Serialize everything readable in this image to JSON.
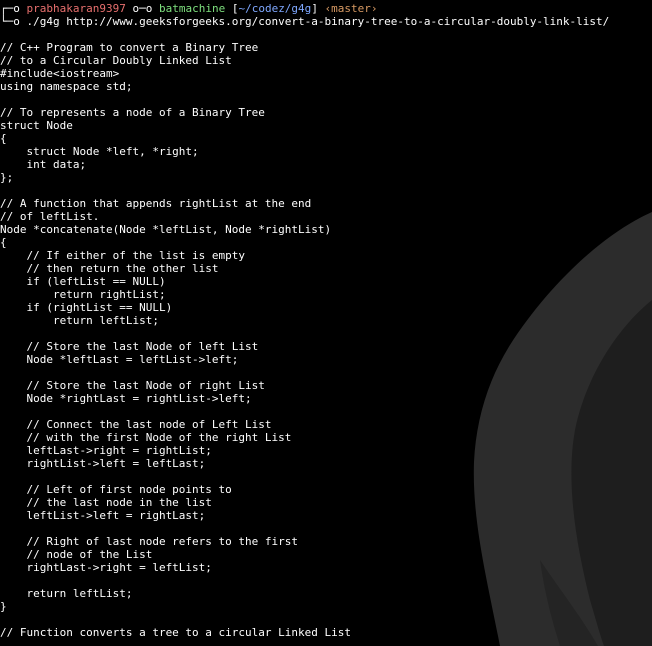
{
  "prompt": {
    "line1": {
      "corner": "┌─o ",
      "user": "prabhakaran9397",
      "sep1": " o─o ",
      "host": "batmachine",
      "space1": " ",
      "dir_open": "[",
      "dir": "~/codez/g4g",
      "dir_close": "]",
      "space2": " ",
      "branch": "‹master›"
    },
    "line2": {
      "corner": "└─o ",
      "command": "./g4g http://www.geeksforgeeks.org/convert-a-binary-tree-to-a-circular-doubly-link-list/"
    }
  },
  "colors": {
    "background": "#000000",
    "text": "#ffffff",
    "user": "#e8706e",
    "host": "#7ee07e",
    "dir": "#7fa8ff",
    "branch": "#d89a63",
    "art": "#2c2c2c"
  },
  "code_lines": [
    "",
    "// C++ Program to convert a Binary Tree",
    "// to a Circular Doubly Linked List",
    "#include<iostream>",
    "using namespace std;",
    "",
    "// To represents a node of a Binary Tree",
    "struct Node",
    "{",
    "    struct Node *left, *right;",
    "    int data;",
    "};",
    "",
    "// A function that appends rightList at the end",
    "// of leftList.",
    "Node *concatenate(Node *leftList, Node *rightList)",
    "{",
    "    // If either of the list is empty",
    "    // then return the other list",
    "    if (leftList == NULL)",
    "        return rightList;",
    "    if (rightList == NULL)",
    "        return leftList;",
    "",
    "    // Store the last Node of left List",
    "    Node *leftLast = leftList->left;",
    "",
    "    // Store the last Node of right List",
    "    Node *rightLast = rightList->left;",
    "",
    "    // Connect the last node of Left List",
    "    // with the first Node of the right List",
    "    leftLast->right = rightList;",
    "    rightList->left = leftLast;",
    "",
    "    // Left of first node points to",
    "    // the last node in the list",
    "    leftList->left = rightLast;",
    "",
    "    // Right of last node refers to the first",
    "    // node of the List",
    "    rightLast->right = leftList;",
    "",
    "    return leftList;",
    "}",
    "",
    "// Function converts a tree to a circular Linked List"
  ]
}
